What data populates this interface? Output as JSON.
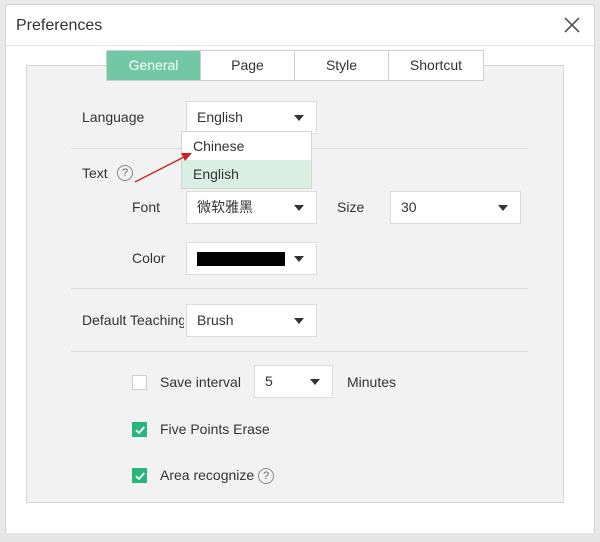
{
  "dialog": {
    "title": "Preferences"
  },
  "tabs": [
    {
      "label": "General",
      "active": true
    },
    {
      "label": "Page",
      "active": false
    },
    {
      "label": "Style",
      "active": false
    },
    {
      "label": "Shortcut",
      "active": false
    }
  ],
  "language": {
    "label": "Language",
    "value": "English",
    "options": [
      "Chinese",
      "English"
    ],
    "selected_option": "English"
  },
  "text": {
    "label": "Text",
    "help_glyph": "?",
    "font_label": "Font",
    "font_value": "微软雅黑",
    "size_label": "Size",
    "size_value": "30",
    "color_label": "Color",
    "color_value": "#000000"
  },
  "teaching": {
    "label": "Default Teaching Pen",
    "value": "Brush"
  },
  "save_interval": {
    "label": "Save interval",
    "value": "5",
    "unit": "Minutes",
    "checked": false
  },
  "five_points_erase": {
    "label": "Five Points Erase",
    "checked": true
  },
  "area_recognize": {
    "label": "Area recognize",
    "checked": true,
    "help_glyph": "?"
  },
  "colors": {
    "accent": "#72c8a5",
    "check": "#28b77a",
    "annotation_arrow": "#cc2222"
  }
}
